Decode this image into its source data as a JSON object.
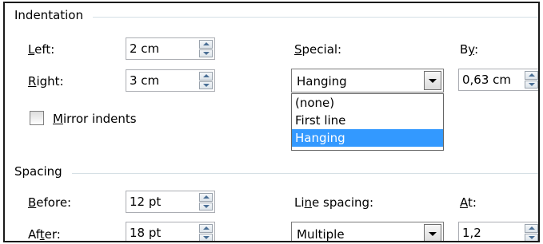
{
  "indentation": {
    "title": "Indentation",
    "left": {
      "label": "Left:",
      "key": "L",
      "rest": "eft:",
      "value": "2 cm"
    },
    "right": {
      "label": "Right:",
      "key": "R",
      "rest": "ight:",
      "value": "3 cm"
    },
    "mirror": {
      "pre": "",
      "key": "M",
      "rest": "irror indents",
      "checked": false
    },
    "special": {
      "key": "S",
      "rest": "pecial:",
      "value": "Hanging",
      "options": [
        "(none)",
        "First line",
        "Hanging"
      ],
      "selected_index": 2
    },
    "by": {
      "pre": "B",
      "key": "y",
      "rest": ":",
      "value": "0,63 cm"
    }
  },
  "spacing": {
    "title": "Spacing",
    "before": {
      "key": "B",
      "rest": "efore:",
      "value": "12 pt"
    },
    "after": {
      "pre": "Af",
      "key": "t",
      "rest": "er:",
      "value": "18 pt"
    },
    "line_spacing": {
      "pre": "Li",
      "key": "n",
      "rest": "e spacing:",
      "value": "Multiple"
    },
    "at": {
      "key": "A",
      "rest": "t:",
      "value": "1,2"
    }
  },
  "colors": {
    "selection": "#3399ff",
    "border": "#abadb3",
    "group_line": "#d5dfe5"
  },
  "icons": [
    "spin-up-icon",
    "spin-down-icon",
    "dropdown-arrow-icon"
  ]
}
